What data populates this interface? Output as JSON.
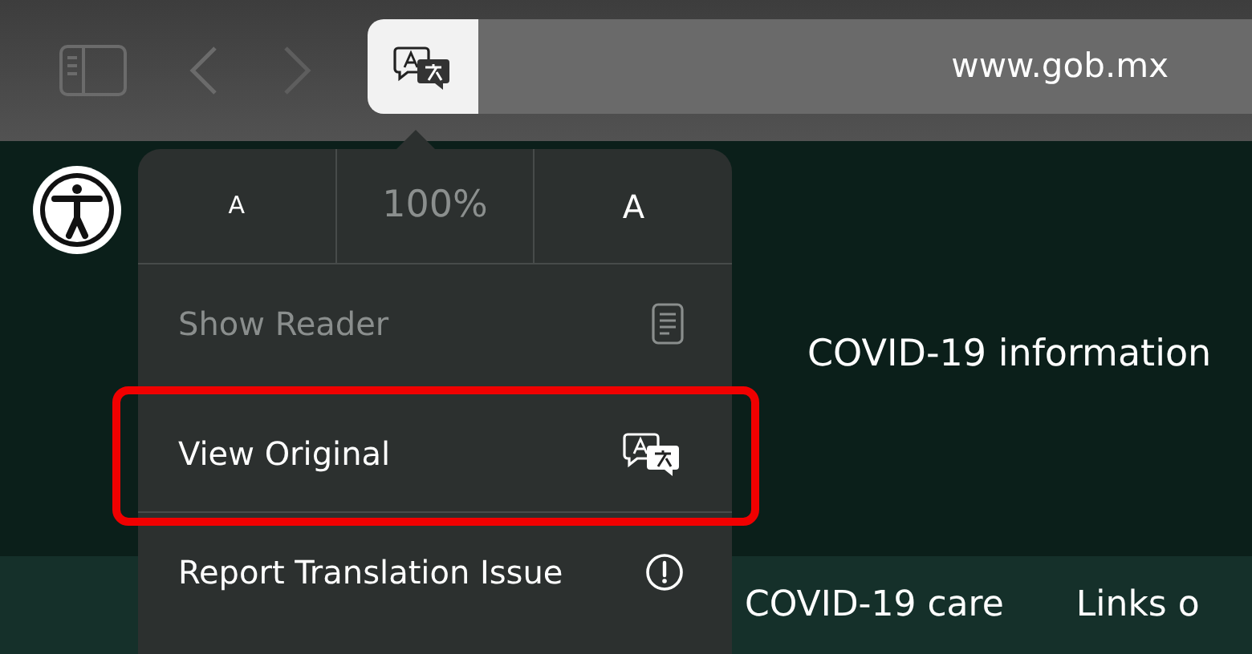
{
  "toolbar": {
    "url": "www.gob.mx"
  },
  "zoom": {
    "smaller": "A",
    "percent": "100%",
    "larger": "A"
  },
  "menu_items": [
    {
      "label": "Show Reader",
      "kind": "reader",
      "disabled": true,
      "highlighted": false
    },
    {
      "label": "View Original",
      "kind": "translate",
      "disabled": false,
      "highlighted": true
    },
    {
      "label": "Report Translation Issue",
      "kind": "info",
      "disabled": false,
      "highlighted": false
    }
  ],
  "page": {
    "heading": "COVID-19 information",
    "nav": [
      "COVID-19 care",
      "Links o"
    ]
  }
}
